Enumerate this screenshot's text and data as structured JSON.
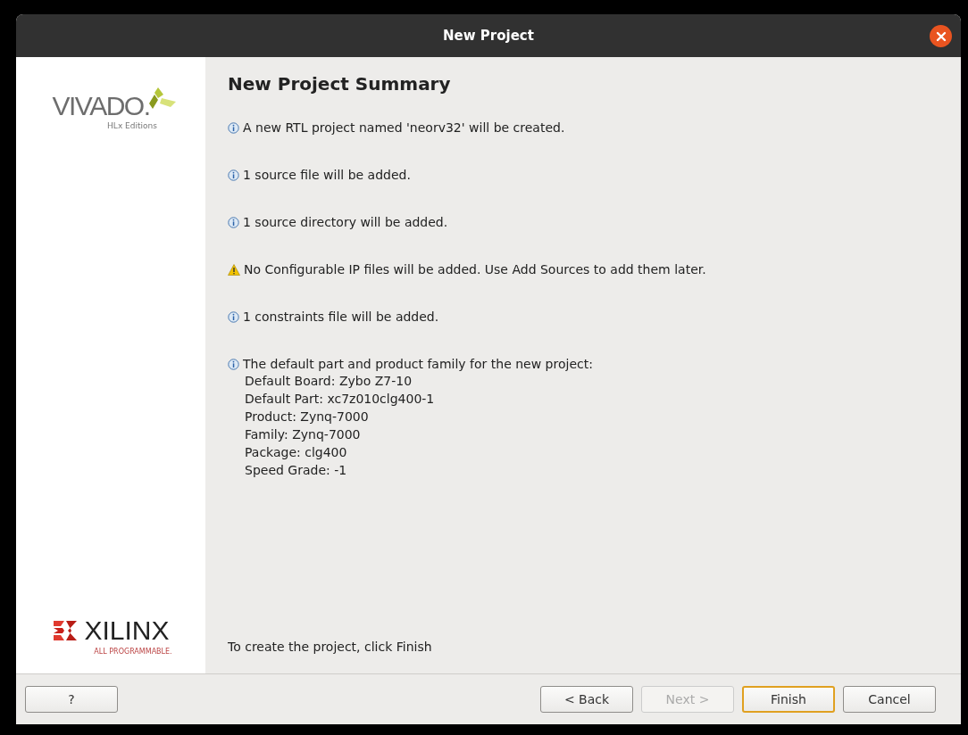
{
  "window": {
    "title": "New Project"
  },
  "sidebar": {
    "logo_top": {
      "name": "VIVADO.",
      "edition": "HLx Editions"
    },
    "logo_bottom": {
      "name": "XILINX",
      "tagline": "ALL PROGRAMMABLE."
    }
  },
  "heading": "New Project Summary",
  "messages": [
    {
      "kind": "info",
      "text": "A new RTL project named 'neorv32' will be created."
    },
    {
      "kind": "info",
      "text": "1 source file will be added."
    },
    {
      "kind": "info",
      "text": "1 source directory will be added."
    },
    {
      "kind": "warning",
      "text": "No Configurable IP files will be added. Use Add Sources to add them later."
    },
    {
      "kind": "info",
      "text": "1 constraints file will be added."
    },
    {
      "kind": "info",
      "text": "The default part and product family for the new project:",
      "details": [
        "Default Board: Zybo Z7-10",
        "Default Part: xc7z010clg400-1",
        "Product: Zynq-7000",
        "Family: Zynq-7000",
        "Package: clg400",
        "Speed Grade: -1"
      ]
    }
  ],
  "footer_note": "To create the project, click Finish",
  "buttons": [
    {
      "label": "?",
      "disabled": false,
      "selected": false
    },
    {
      "label": "< Back",
      "disabled": false,
      "selected": false
    },
    {
      "label": "Next >",
      "disabled": true,
      "selected": false
    },
    {
      "label": "Finish",
      "disabled": false,
      "selected": true
    },
    {
      "label": "Cancel",
      "disabled": false,
      "selected": false
    }
  ]
}
